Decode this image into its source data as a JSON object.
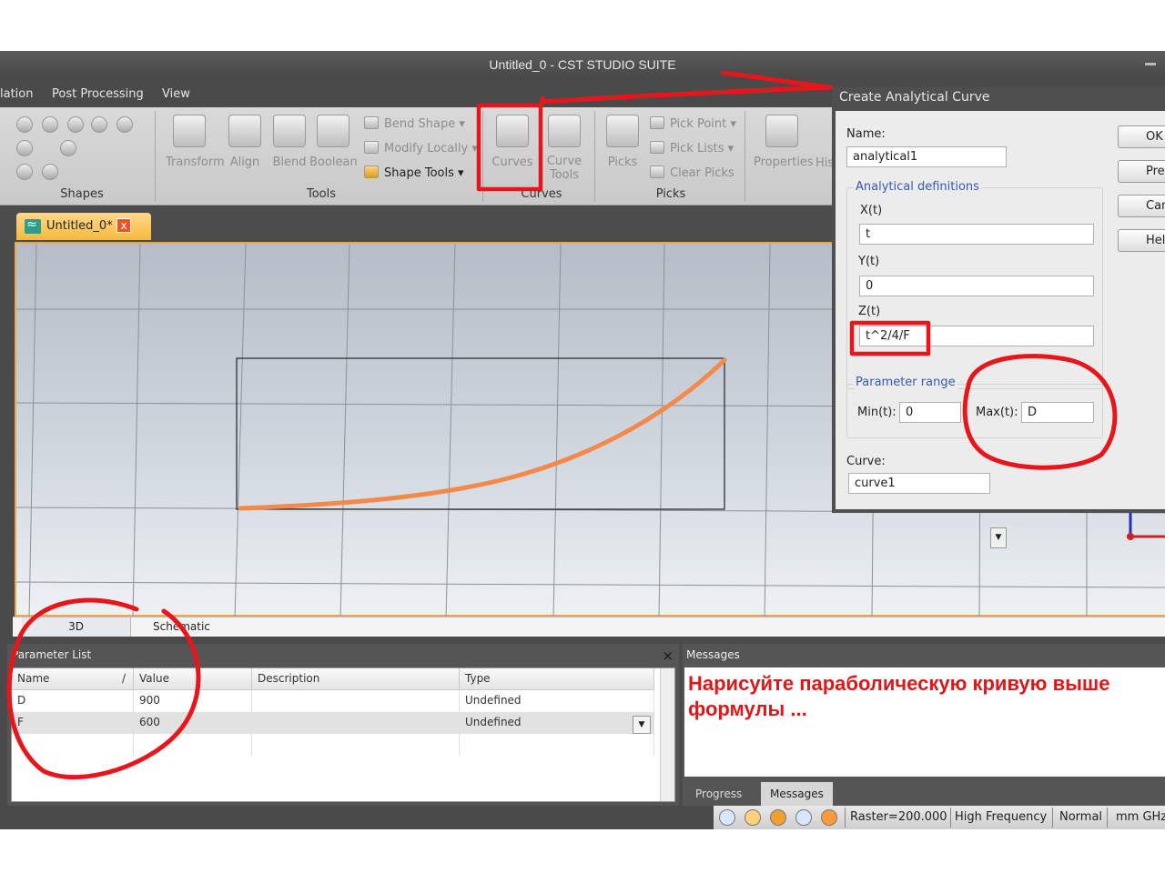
{
  "window": {
    "title": "Untitled_0 - CST STUDIO SUITE"
  },
  "menu": [
    "lation",
    "Post Processing",
    "View"
  ],
  "ribbon": {
    "groups": [
      "Shapes",
      "Tools",
      "Curves",
      "Picks"
    ],
    "tools_buttons": [
      "Transform",
      "Align",
      "Blend",
      "Boolean"
    ],
    "tools_small": [
      "Bend Shape",
      "Modify Locally",
      "Shape Tools"
    ],
    "curves_buttons": {
      "curves": "Curves",
      "curve_tools_1": "Curve",
      "curve_tools_2": "Tools"
    },
    "picks_button": "Picks",
    "picks_small": [
      "Pick Point",
      "Pick Lists",
      "Clear Picks"
    ],
    "properties": "Properties",
    "history_partial": "His"
  },
  "doc_tab": {
    "label": "Untitled_0*",
    "close": "x"
  },
  "view_tabs": [
    "3D",
    "Schematic"
  ],
  "parameter_list": {
    "title": "Parameter List",
    "close": "×",
    "columns": [
      "Name",
      "Value",
      "Description",
      "Type"
    ],
    "sort_marker": "/",
    "rows": [
      {
        "name": "D",
        "value": "900",
        "description": "",
        "type": "Undefined"
      },
      {
        "name": "F",
        "value": "600",
        "description": "",
        "type": "Undefined"
      }
    ]
  },
  "messages": {
    "title": "Messages",
    "text": "Нарисуйте параболическую кривую выше формулы ...",
    "tabs": [
      "Progress",
      "Messages"
    ]
  },
  "status_bar": {
    "raster": "Raster=200.000",
    "mode": "High Frequency",
    "state": "Normal",
    "units": "mm  GHz"
  },
  "dialog": {
    "title": "Create Analytical Curve",
    "name_label": "Name:",
    "name_value": "analytical1",
    "analytical_group": "Analytical definitions",
    "x_label": "X(t)",
    "x_value": "t",
    "y_label": "Y(t)",
    "y_value": "0",
    "z_label": "Z(t)",
    "z_value": "t^2/4/F",
    "range_group": "Parameter range",
    "min_label": "Min(t):",
    "min_value": "0",
    "max_label": "Max(t):",
    "max_value": "D",
    "curve_label": "Curve:",
    "curve_value": "curve1",
    "buttons": [
      "OK",
      "Previ",
      "Canc",
      "Help"
    ]
  },
  "colors": {
    "annotation_red": "#e8161b",
    "curve_orange": "#f5894a",
    "tab_orange": "#f6b93d"
  }
}
